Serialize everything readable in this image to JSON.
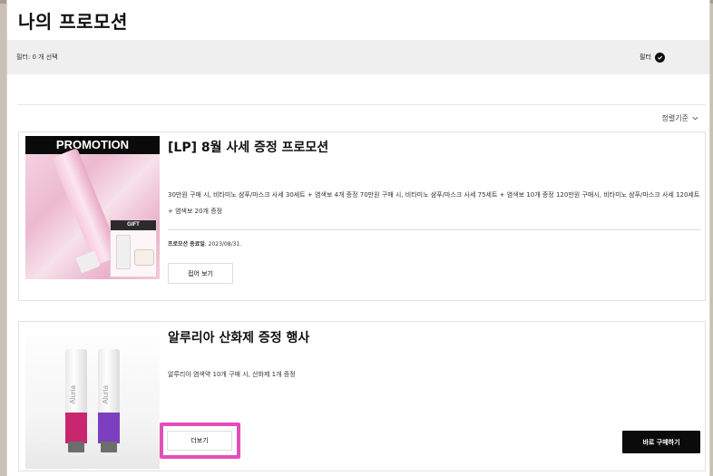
{
  "page": {
    "title": "나의 프로모션"
  },
  "filter_bar": {
    "count_text": "필터: 0 개 선택",
    "filter_label": "필터"
  },
  "sort": {
    "label": "정렬기준"
  },
  "promotions": [
    {
      "banner": "PROMOTION",
      "gift_label": "GIFT",
      "title": "[LP] 8월 사세 증정 프로모션",
      "description": "30만원 구매 시, 비타미노 샴푸/마스크 사세 30세트 + 염색보 4개 증정 70만원 구매 시, 비타미노 샴푸/마스크 사세 75세트 + 염색보 10개 증정 120만원 구매시, 비타미노 샴푸/마스크 사세 120세트 + 염색보 20개 증정",
      "end_date_label": "프로모션 종료일",
      "end_date": ": 2023/08/31.",
      "button": "접어 보기"
    },
    {
      "title": "알루리아 산화제 증정 행사",
      "description": "알루리아 염색약 10개 구매 시, 산화제 1개 증정",
      "button": "더보기",
      "buy_button": "바로 구매하기",
      "tube_colors": [
        "#c8266e",
        "#7b3fbf"
      ]
    }
  ]
}
